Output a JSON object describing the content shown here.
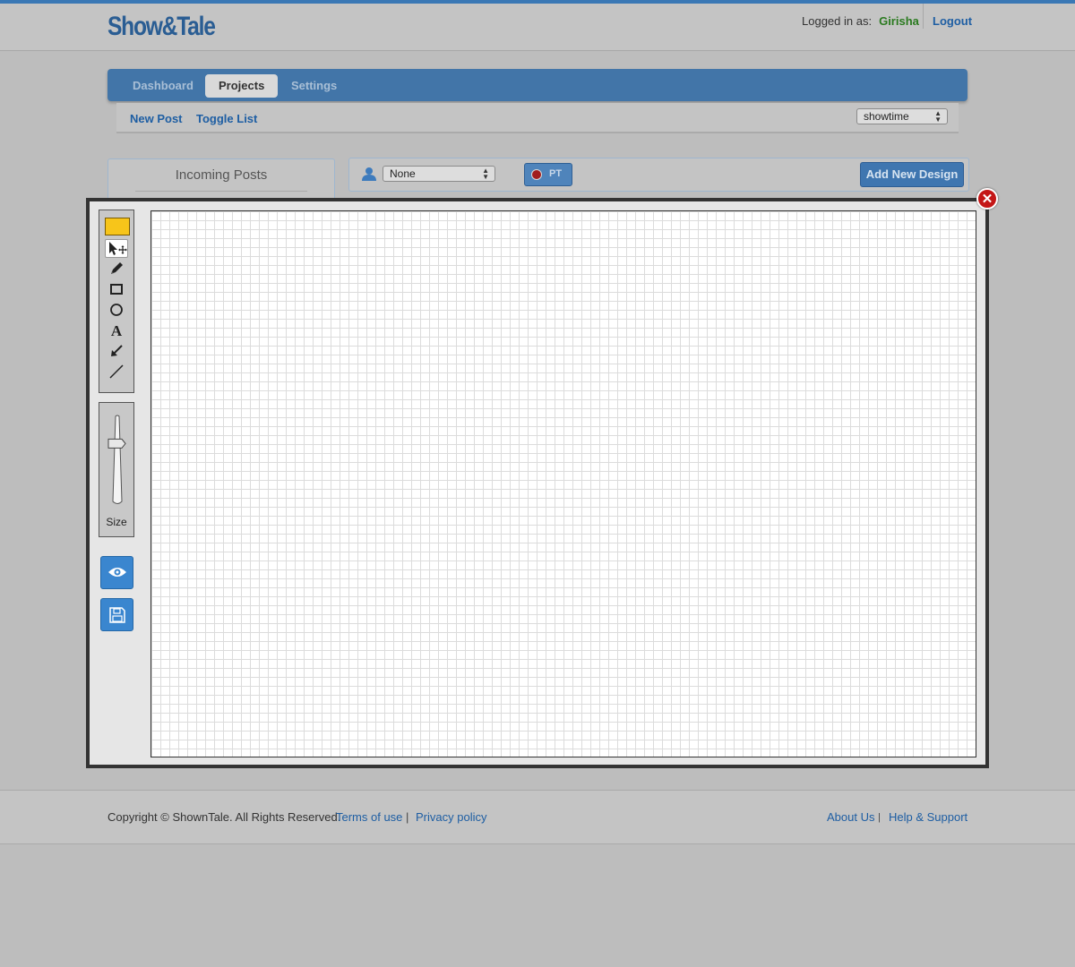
{
  "app": {
    "logo": "Show&Tale"
  },
  "header": {
    "logged_in_label": "Logged in as:",
    "username": "Girisha",
    "logout": "Logout"
  },
  "nav": {
    "tabs": [
      {
        "label": "Dashboard",
        "active": false
      },
      {
        "label": "Projects",
        "active": true
      },
      {
        "label": "Settings",
        "active": false
      }
    ]
  },
  "subnav": {
    "new_post": "New Post",
    "toggle_list": "Toggle List",
    "project_select": "showtime"
  },
  "incoming": {
    "title": "Incoming Posts"
  },
  "designbar": {
    "assignee_select": "None",
    "pt_label": "PT",
    "add_design": "Add New Design"
  },
  "editor": {
    "selected_color": "#f7c51a",
    "tools": [
      {
        "icon": "pointer-move-icon",
        "selected": true
      },
      {
        "icon": "pencil-icon",
        "selected": false
      },
      {
        "icon": "rectangle-icon",
        "selected": false
      },
      {
        "icon": "circle-icon",
        "selected": false
      },
      {
        "icon": "text-icon",
        "selected": false
      },
      {
        "icon": "arrow-icon",
        "selected": false
      },
      {
        "icon": "line-icon",
        "selected": false
      }
    ],
    "size_label": "Size",
    "size_level_fraction": 0.33,
    "preview_icon": "eye-icon",
    "save_icon": "floppy-disk-icon",
    "close_icon": "close-icon"
  },
  "footer": {
    "copyright": "Copyright © ShownTale. All Rights Reserved.",
    "terms": "Terms of use",
    "separator": "|",
    "privacy": "Privacy policy",
    "about": "About Us",
    "help": "Help & Support"
  }
}
